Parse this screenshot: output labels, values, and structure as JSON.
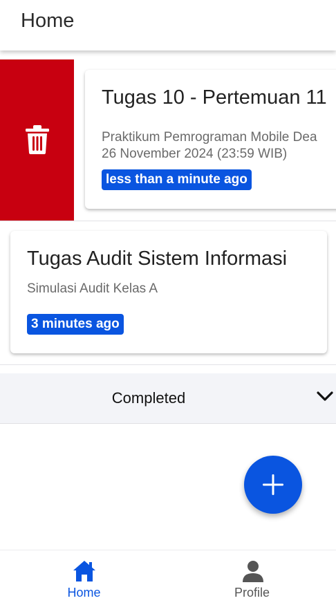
{
  "appbar": {
    "title": "Home"
  },
  "tasks": [
    {
      "title": "Tugas 10 - Pertemuan 11",
      "subtitle_line1": "Praktikum Pemrograman Mobile Dea",
      "subtitle_line2": "26 November 2024 (23:59 WIB)",
      "time_ago": "less than a minute ago"
    },
    {
      "title": "Tugas Audit Sistem Informasi",
      "subtitle_line1": "Simulasi Audit Kelas A",
      "time_ago": "3 minutes ago"
    }
  ],
  "swipe_action": {
    "icon": "trash-icon",
    "color": "#c80010"
  },
  "completed_section": {
    "label": "Completed",
    "icon": "chevron-down-icon",
    "expanded": false
  },
  "fab": {
    "icon": "plus-icon",
    "color": "#0a55e0"
  },
  "bottom_nav": {
    "items": [
      {
        "label": "Home",
        "icon": "home-icon",
        "active": true,
        "color": "#0a55e0"
      },
      {
        "label": "Profile",
        "icon": "person-icon",
        "active": false,
        "color": "#555555"
      }
    ]
  },
  "colors": {
    "accent": "#0a55e0",
    "delete": "#c80010"
  }
}
